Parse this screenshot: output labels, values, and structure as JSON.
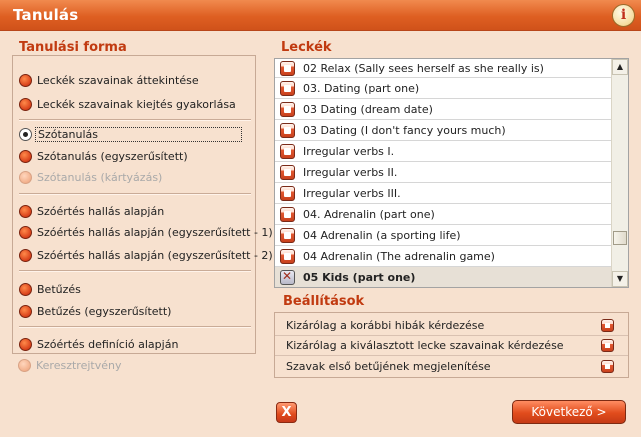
{
  "window": {
    "title": "Tanulás",
    "info_icon_glyph": "i"
  },
  "left_panel": {
    "title": "Tanulási forma",
    "options": [
      {
        "label": "Leckék szavainak áttekintése",
        "state": "normal"
      },
      {
        "label": "Leckék szavainak kiejtés gyakorlása",
        "state": "normal"
      },
      {
        "label": "Szótanulás",
        "state": "selected"
      },
      {
        "label": "Szótanulás (egyszerűsített)",
        "state": "normal"
      },
      {
        "label": "Szótanulás (kártyázás)",
        "state": "disabled"
      },
      {
        "label": "Szóértés hallás alapján",
        "state": "normal"
      },
      {
        "label": "Szóértés hallás alapján (egyszerűsített - 1)",
        "state": "normal"
      },
      {
        "label": "Szóértés hallás alapján (egyszerűsített - 2)",
        "state": "normal"
      },
      {
        "label": "Betűzés",
        "state": "normal"
      },
      {
        "label": "Betűzés (egyszerűsített)",
        "state": "normal"
      },
      {
        "label": "Szóértés definíció alapján",
        "state": "normal"
      },
      {
        "label": "Keresztrejtvény",
        "state": "disabled"
      }
    ]
  },
  "lessons_panel": {
    "title": "Leckék",
    "items": [
      {
        "label": "02 Relax (Sally sees herself as she really is)",
        "checked": false
      },
      {
        "label": "03. Dating (part one)",
        "checked": false
      },
      {
        "label": "03 Dating (dream date)",
        "checked": false
      },
      {
        "label": "03 Dating (I don't fancy yours much)",
        "checked": false
      },
      {
        "label": "Irregular verbs  I.",
        "checked": false
      },
      {
        "label": "Irregular verbs  II.",
        "checked": false
      },
      {
        "label": "Irregular verbs  III.",
        "checked": false
      },
      {
        "label": "04. Adrenalin (part one)",
        "checked": false
      },
      {
        "label": "04 Adrenalin (a sporting life)",
        "checked": false
      },
      {
        "label": "04 Adrenalin (The adrenalin game)",
        "checked": false
      },
      {
        "label": "05 Kids (part one)",
        "checked": true
      }
    ],
    "scroll_up_glyph": "▲",
    "scroll_down_glyph": "▼"
  },
  "settings_panel": {
    "title": "Beállítások",
    "items": [
      {
        "label": "Kizárólag a korábbi hibák kérdezése",
        "checked": false
      },
      {
        "label": "Kizárólag a kiválasztott lecke szavainak kérdezése",
        "checked": false
      },
      {
        "label": "Szavak első betűjének megjelenítése",
        "checked": false
      }
    ]
  },
  "footer": {
    "cancel_glyph": "X",
    "next_label": "Következő >"
  },
  "colors": {
    "accent": "#de5f22",
    "panel_title": "#c13a10",
    "background": "#f7e1cf"
  }
}
